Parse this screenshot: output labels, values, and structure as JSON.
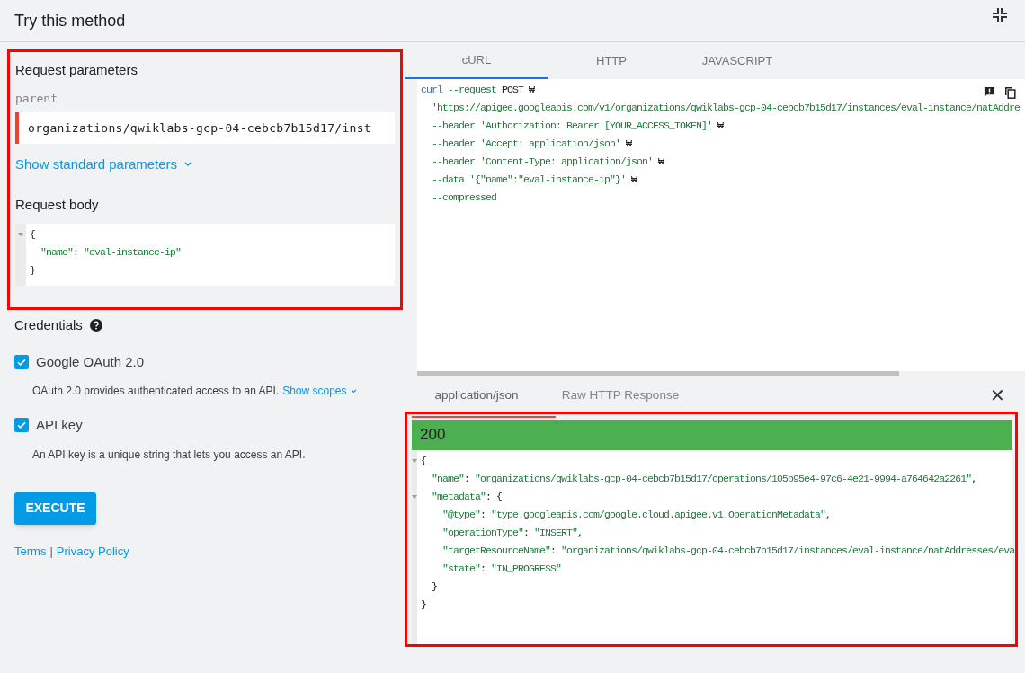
{
  "title": "Try this method",
  "request_parameters": {
    "heading": "Request parameters",
    "param_label": "parent",
    "param_value": "organizations/qwiklabs-gcp-04-cebcb7b15d17/inst",
    "show_standard": "Show standard parameters",
    "body_heading": "Request body",
    "body_lines": [
      [
        {
          "kind": "plain",
          "text": "{"
        }
      ],
      [
        {
          "kind": "string",
          "text": "  \"name\""
        },
        {
          "kind": "plain",
          "text": ": "
        },
        {
          "kind": "string",
          "text": "\"eval-instance-ip\""
        }
      ],
      [
        {
          "kind": "plain",
          "text": "}"
        }
      ]
    ]
  },
  "credentials": {
    "heading": "Credentials",
    "items": [
      {
        "label": "Google OAuth 2.0",
        "checked": true,
        "description": "OAuth 2.0 provides authenticated access to an API.",
        "link": "Show scopes"
      },
      {
        "label": "API key",
        "checked": true,
        "description": "An API key is a unique string that lets you access an API."
      }
    ]
  },
  "execute": "EXECUTE",
  "footer_links": [
    {
      "text": "Terms"
    },
    {
      "kind": "separator",
      "text": "|"
    },
    {
      "text": "Privacy Policy"
    }
  ],
  "code_tabs": [
    {
      "label": "cURL",
      "selected": true
    },
    {
      "label": "HTTP",
      "selected": false
    },
    {
      "label": "JAVASCRIPT",
      "selected": false
    }
  ],
  "code_lines": [
    [
      {
        "kind": "keyword",
        "text": "curl"
      },
      {
        "kind": "string",
        "text": " --request "
      },
      {
        "kind": "plain",
        "text": "POST ₩"
      }
    ],
    [
      {
        "kind": "string",
        "text": "  'https://apigee.googleapis.com/v1/organizations/qwiklabs-gcp-04-cebcb7b15d17/instances/eval-instance/natAddre"
      }
    ],
    [
      {
        "kind": "string",
        "text": "  --header 'Authorization: Bearer [YOUR_ACCESS_TOKEN]'"
      },
      {
        "kind": "plain",
        "text": " ₩"
      }
    ],
    [
      {
        "kind": "string",
        "text": "  --header 'Accept: application/json'"
      },
      {
        "kind": "plain",
        "text": " ₩"
      }
    ],
    [
      {
        "kind": "string",
        "text": "  --header 'Content-Type: application/json'"
      },
      {
        "kind": "plain",
        "text": " ₩"
      }
    ],
    [
      {
        "kind": "string",
        "text": "  --data '{\"name\":\"eval-instance-ip\"}'"
      },
      {
        "kind": "plain",
        "text": " ₩"
      }
    ],
    [
      {
        "kind": "string",
        "text": "  --compressed"
      }
    ]
  ],
  "response_tabs": [
    {
      "label": "application/json",
      "selected": true
    },
    {
      "label": "Raw HTTP Response",
      "selected": false
    }
  ],
  "close": "✕",
  "status": "200",
  "response_lines": [
    {
      "fold": true,
      "tokens": [
        {
          "kind": "plain",
          "text": "{"
        }
      ]
    },
    {
      "fold": false,
      "tokens": [
        {
          "kind": "string",
          "text": "  \"name\""
        },
        {
          "kind": "plain",
          "text": ": "
        },
        {
          "kind": "string",
          "text": "\"organizations/qwiklabs-gcp-04-cebcb7b15d17/operations/105b95e4-97c6-4e21-9994-a764642a2261\""
        },
        {
          "kind": "plain",
          "text": ","
        }
      ]
    },
    {
      "fold": true,
      "tokens": [
        {
          "kind": "string",
          "text": "  \"metadata\""
        },
        {
          "kind": "plain",
          "text": ": {"
        }
      ]
    },
    {
      "fold": false,
      "tokens": [
        {
          "kind": "string",
          "text": "    \"@type\""
        },
        {
          "kind": "plain",
          "text": ": "
        },
        {
          "kind": "string",
          "text": "\"type.googleapis.com/google.cloud.apigee.v1.OperationMetadata\""
        },
        {
          "kind": "plain",
          "text": ","
        }
      ]
    },
    {
      "fold": false,
      "tokens": [
        {
          "kind": "string",
          "text": "    \"operationType\""
        },
        {
          "kind": "plain",
          "text": ": "
        },
        {
          "kind": "string",
          "text": "\"INSERT\""
        },
        {
          "kind": "plain",
          "text": ","
        }
      ]
    },
    {
      "fold": false,
      "tokens": [
        {
          "kind": "string",
          "text": "    \"targetResourceName\""
        },
        {
          "kind": "plain",
          "text": ": "
        },
        {
          "kind": "string",
          "text": "\"organizations/qwiklabs-gcp-04-cebcb7b15d17/instances/eval-instance/natAddresses/eva"
        }
      ]
    },
    {
      "fold": false,
      "tokens": [
        {
          "kind": "string",
          "text": "    \"state\""
        },
        {
          "kind": "plain",
          "text": ": "
        },
        {
          "kind": "string",
          "text": "\"IN_PROGRESS\""
        }
      ]
    },
    {
      "fold": false,
      "tokens": [
        {
          "kind": "plain",
          "text": "  }"
        }
      ]
    },
    {
      "fold": false,
      "tokens": [
        {
          "kind": "plain",
          "text": "}"
        }
      ]
    }
  ]
}
